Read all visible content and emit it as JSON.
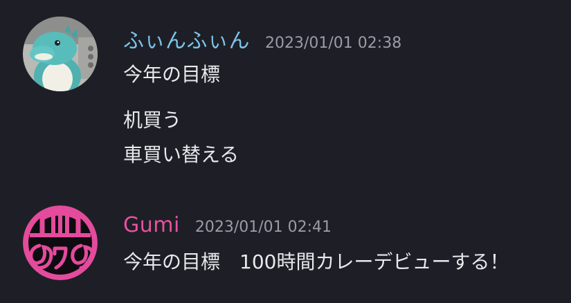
{
  "messages": [
    {
      "username": "ふぃんふぃん",
      "username_color": "#7cc3ea",
      "timestamp": "2023/01/01 02:38",
      "avatar_icon": "plush-dinosaur-avatar-icon",
      "lines": [
        "今年の目標",
        "机買う",
        "車買い替える"
      ]
    },
    {
      "username": "Gumi",
      "username_color": "#e852a0",
      "timestamp": "2023/01/01 02:41",
      "avatar_icon": "pink-nowano-logo-avatar-icon",
      "lines": [
        "今年の目標　100時間カレーデビューする！"
      ]
    }
  ]
}
